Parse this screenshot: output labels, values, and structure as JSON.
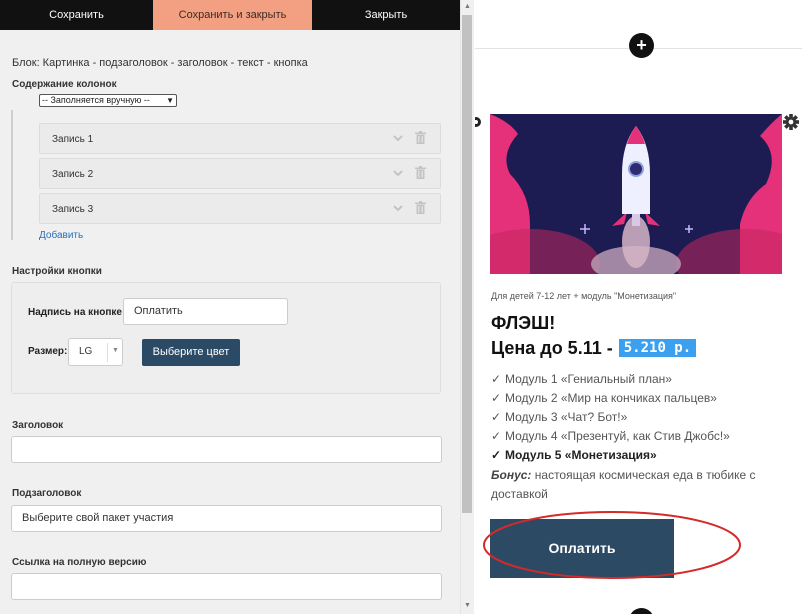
{
  "toolbar": {
    "save_label": "Сохранить",
    "save_close_label": "Сохранить и закрыть",
    "close_label": "Закрыть"
  },
  "editor": {
    "block_title": "Блок: Картинка - подзаголовок - заголовок - текст - кнопка",
    "columns_section": "Содержание колонок",
    "columns_select": "-- Заполняется вручную --",
    "records": [
      "Запись 1",
      "Запись 2",
      "Запись 3"
    ],
    "add_label": "Добавить",
    "button_settings_section": "Настройки кнопки",
    "button_caption_label": "Надпись на кнопке:",
    "button_caption_value": "Оплатить",
    "size_label": "Размер:",
    "size_value": "LG",
    "choose_color_label": "Выберите цвет",
    "heading_label": "Заголовок",
    "heading_value": "",
    "subheading_label": "Подзаголовок",
    "subheading_value": "Выберите свой пакет участия",
    "full_version_link_label": "Ссылка на полную версию",
    "full_version_link_value": ""
  },
  "preview": {
    "tagline": "Для детей 7-12 лет + модуль \"Монетизация\"",
    "title": "ФЛЭШ!",
    "price_prefix": "Цена до 5.11 -",
    "price": "5.210 р.",
    "modules": [
      "Модуль 1 «Гениальный план»",
      "Модуль 2 «Мир на кончиках пальцев»",
      "Модуль 3 «Чат? Бот!»",
      "Модуль 4 «Презентуй, как Стив Джобс!»",
      "Модуль 5 «Монетизация»"
    ],
    "bonus_label": "Бонус:",
    "bonus_text": "настоящая космическая еда в тюбике с доставкой",
    "pay_button": "Оплатить",
    "check_mark": "✓",
    "plus": "+"
  },
  "colors": {
    "toolbar_bg": "#111111",
    "save_close_bg": "#f3a082",
    "dark_button": "#2b4a66",
    "price_badge": "#3aa0ef",
    "hero_bg": "#1c1b52",
    "hero_pink": "#e5307a",
    "annotation_red": "#d42a2a"
  },
  "icons": {
    "record_expand": "chevron-down-icon",
    "record_delete": "trash-icon",
    "block_settings": "gear-icon",
    "add_block": "plus-icon"
  }
}
